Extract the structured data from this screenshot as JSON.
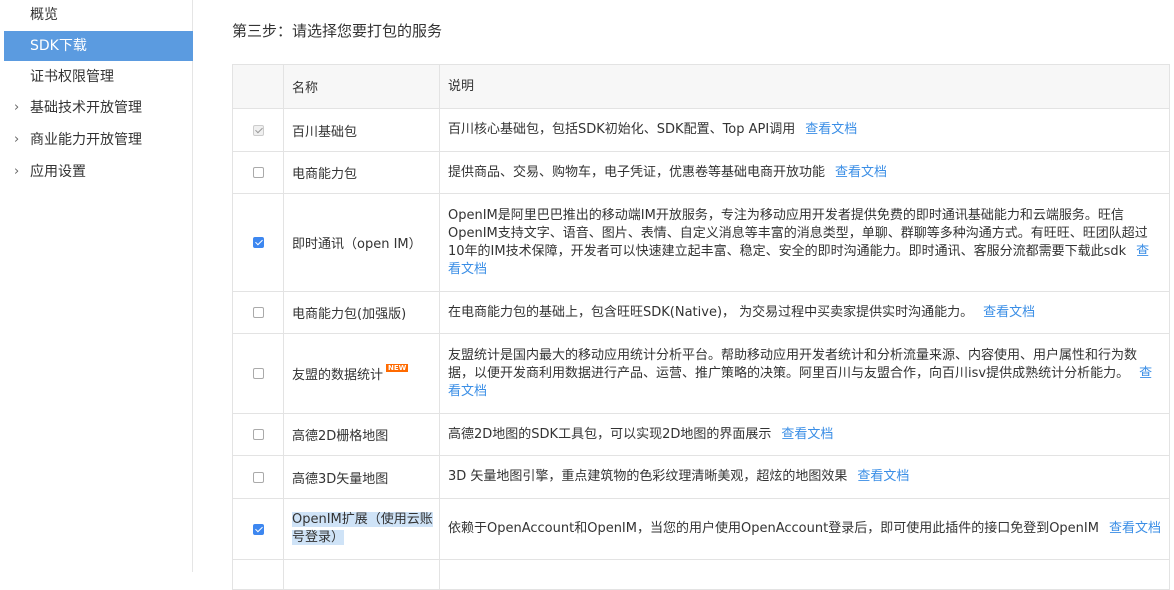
{
  "sidebar": {
    "items": [
      {
        "label": "概览",
        "active": false,
        "expandable": false
      },
      {
        "label": "SDK下载",
        "active": true,
        "expandable": false
      },
      {
        "label": "证书权限管理",
        "active": false,
        "expandable": false
      },
      {
        "label": "基础技术开放管理",
        "active": false,
        "expandable": true
      },
      {
        "label": "商业能力开放管理",
        "active": false,
        "expandable": true
      },
      {
        "label": "应用设置",
        "active": false,
        "expandable": true
      }
    ]
  },
  "main": {
    "step_title": "第三步：请选择您要打包的服务",
    "table": {
      "headers": {
        "name": "名称",
        "description": "说明"
      },
      "rows": [
        {
          "state": "disabled-checked",
          "name": "百川基础包",
          "description": "百川核心基础包，包括SDK初始化、SDK配置、Top API调用",
          "link": "查看文档"
        },
        {
          "state": "unchecked",
          "name": "电商能力包",
          "description": "提供商品、交易、购物车，电子凭证，优惠卷等基础电商开放功能",
          "link": "查看文档"
        },
        {
          "state": "checked",
          "name": "即时通讯（open IM）",
          "description": "OpenIM是阿里巴巴推出的移动端IM开放服务，专注为移动应用开发者提供免费的即时通讯基础能力和云端服务。旺信OpenIM支持文字、语音、图片、表情、自定义消息等丰富的消息类型，单聊、群聊等多种沟通方式。有旺旺、旺团队超过10年的IM技术保障，开发者可以快速建立起丰富、稳定、安全的即时沟通能力。即时通讯、客服分流都需要下载此sdk",
          "link": "查看文档"
        },
        {
          "state": "unchecked",
          "name": "电商能力包(加强版)",
          "description": "在电商能力包的基础上，包含旺旺SDK(Native)， 为交易过程中买卖家提供实时沟通能力。",
          "link": "查看文档"
        },
        {
          "state": "unchecked",
          "name": "友盟的数据统计",
          "badge": "NEW",
          "description": "友盟统计是国内最大的移动应用统计分析平台。帮助移动应用开发者统计和分析流量来源、内容使用、用户属性和行为数据，以便开发商利用数据进行产品、运营、推广策略的决策。阿里百川与友盟合作，向百川isv提供成熟统计分析能力。",
          "link": "查看文档"
        },
        {
          "state": "unchecked",
          "name": "高德2D栅格地图",
          "description": "高德2D地图的SDK工具包，可以实现2D地图的界面展示",
          "link": "查看文档"
        },
        {
          "state": "unchecked",
          "name": "高德3D矢量地图",
          "description": "3D 矢量地图引擎，重点建筑物的色彩纹理清晰美观，超炫的地图效果",
          "link": "查看文档"
        },
        {
          "state": "checked",
          "name": "OpenIM扩展（使用云账号登录）",
          "highlighted": true,
          "description": "依赖于OpenAccount和OpenIM，当您的用户使用OpenAccount登录后，即可使用此插件的接口免登到OpenIM",
          "link": "查看文档"
        }
      ]
    }
  },
  "colors": {
    "accent": "#5b9be0",
    "link": "#3a8ee6",
    "checkbox_checked": "#3d87f0",
    "selection_highlight": "#cfe3f7",
    "badge": "#ff6a00"
  }
}
